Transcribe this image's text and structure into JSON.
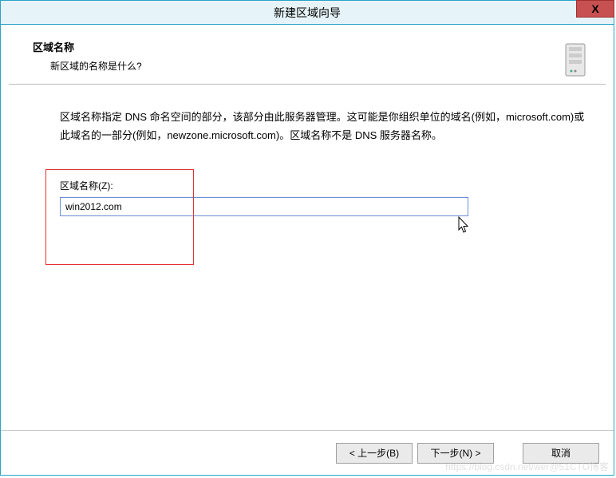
{
  "window": {
    "title": "新建区域向导",
    "close_icon": "X"
  },
  "header": {
    "title": "区域名称",
    "subtitle": "新区域的名称是什么?"
  },
  "body": {
    "description": "区域名称指定 DNS 命名空间的部分，该部分由此服务器管理。这可能是你组织单位的域名(例如，microsoft.com)或此域名的一部分(例如，newzone.microsoft.com)。区域名称不是 DNS 服务器名称。"
  },
  "form": {
    "zone_label": "区域名称(Z):",
    "zone_value": "win2012.com"
  },
  "footer": {
    "back": "< 上一步(B)",
    "next": "下一步(N) >",
    "cancel": "取消"
  },
  "watermark": "https://blog.csdn.net/wer@51CTO博客"
}
